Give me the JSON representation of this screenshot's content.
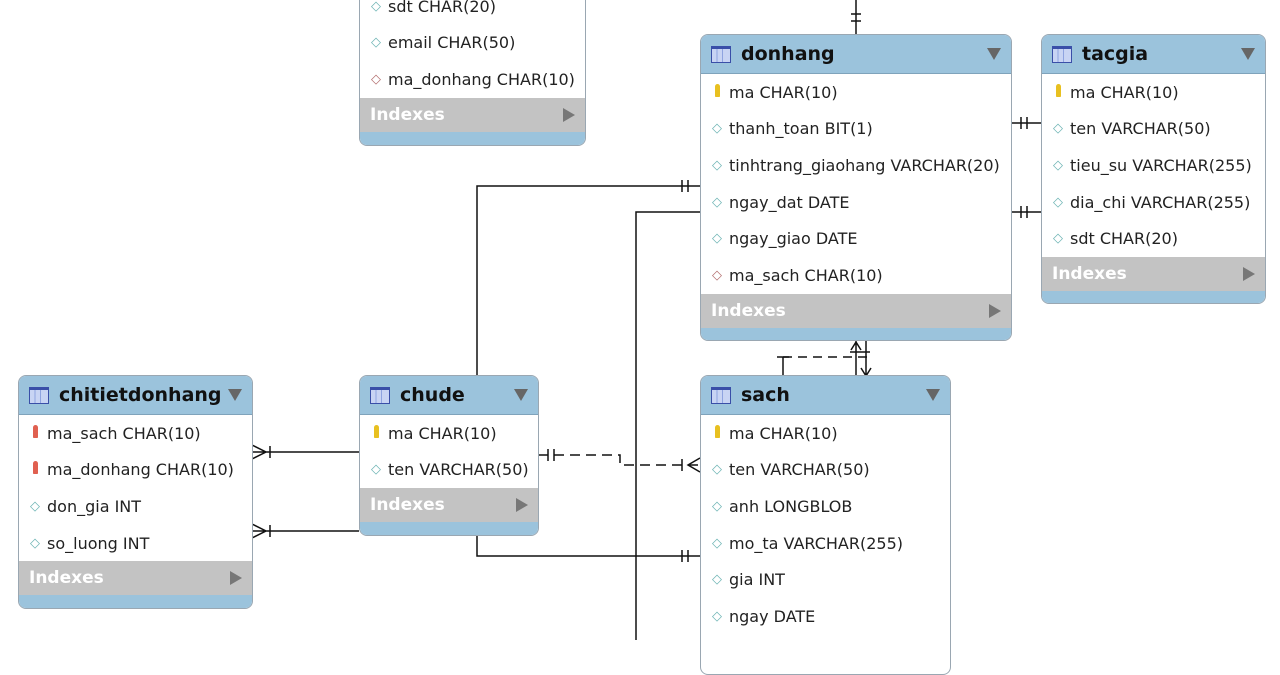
{
  "tables": {
    "partial": {
      "columns": [
        {
          "icon": "attribute",
          "text": "sdt CHAR(20)"
        },
        {
          "icon": "attribute",
          "text": "email CHAR(50)"
        },
        {
          "icon": "foreign-key",
          "text": "ma_donhang CHAR(10)"
        }
      ],
      "indexes": "Indexes"
    },
    "donhang": {
      "name": "donhang",
      "columns": [
        {
          "icon": "primary-key",
          "text": "ma CHAR(10)"
        },
        {
          "icon": "attribute",
          "text": "thanh_toan BIT(1)"
        },
        {
          "icon": "attribute",
          "text": "tinhtrang_giaohang VARCHAR(20)"
        },
        {
          "icon": "attribute",
          "text": "ngay_dat DATE"
        },
        {
          "icon": "attribute",
          "text": "ngay_giao DATE"
        },
        {
          "icon": "foreign-key",
          "text": "ma_sach CHAR(10)"
        }
      ],
      "indexes": "Indexes"
    },
    "tacgia": {
      "name": "tacgia",
      "columns": [
        {
          "icon": "primary-key",
          "text": "ma CHAR(10)"
        },
        {
          "icon": "attribute",
          "text": "ten VARCHAR(50)"
        },
        {
          "icon": "attribute",
          "text": "tieu_su VARCHAR(255)"
        },
        {
          "icon": "attribute",
          "text": "dia_chi VARCHAR(255)"
        },
        {
          "icon": "attribute",
          "text": "sdt CHAR(20)"
        }
      ],
      "indexes": "Indexes"
    },
    "chitietdonhang": {
      "name": "chitietdonhang",
      "columns": [
        {
          "icon": "foreign-primary-key",
          "text": "ma_sach CHAR(10)"
        },
        {
          "icon": "foreign-primary-key",
          "text": "ma_donhang CHAR(10)"
        },
        {
          "icon": "attribute",
          "text": "don_gia INT"
        },
        {
          "icon": "attribute",
          "text": "so_luong INT"
        }
      ],
      "indexes": "Indexes"
    },
    "chude": {
      "name": "chude",
      "columns": [
        {
          "icon": "primary-key",
          "text": "ma CHAR(10)"
        },
        {
          "icon": "attribute",
          "text": "ten VARCHAR(50)"
        }
      ],
      "indexes": "Indexes"
    },
    "sach": {
      "name": "sach",
      "columns": [
        {
          "icon": "primary-key",
          "text": "ma CHAR(10)"
        },
        {
          "icon": "attribute",
          "text": "ten VARCHAR(50)"
        },
        {
          "icon": "attribute",
          "text": "anh LONGBLOB"
        },
        {
          "icon": "attribute",
          "text": "mo_ta VARCHAR(255)"
        },
        {
          "icon": "attribute",
          "text": "gia INT"
        },
        {
          "icon": "attribute",
          "text": "ngay DATE"
        }
      ]
    }
  },
  "colors": {
    "header": "#9bc3dc",
    "indexes": "#c3c3c3",
    "line": "#111111"
  }
}
